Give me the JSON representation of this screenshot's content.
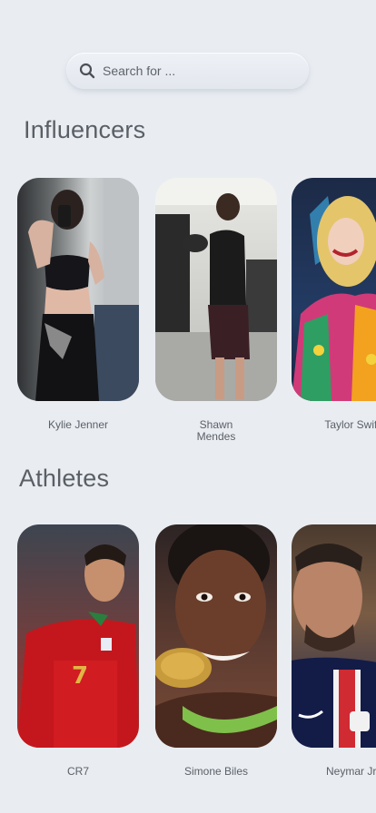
{
  "search": {
    "placeholder": "Search for ...",
    "value": ""
  },
  "sections": {
    "influencers": {
      "title": "Influencers",
      "cards": [
        {
          "name": "Kylie Jenner"
        },
        {
          "name": "Shawn Mendes"
        },
        {
          "name": "Taylor Swift"
        }
      ]
    },
    "athletes": {
      "title": "Athletes",
      "cards": [
        {
          "name": "CR7"
        },
        {
          "name": "Simone Biles"
        },
        {
          "name": "Neymar Jr."
        }
      ]
    }
  },
  "colors": {
    "background": "#e9edf2",
    "text": "#5a5f66"
  }
}
